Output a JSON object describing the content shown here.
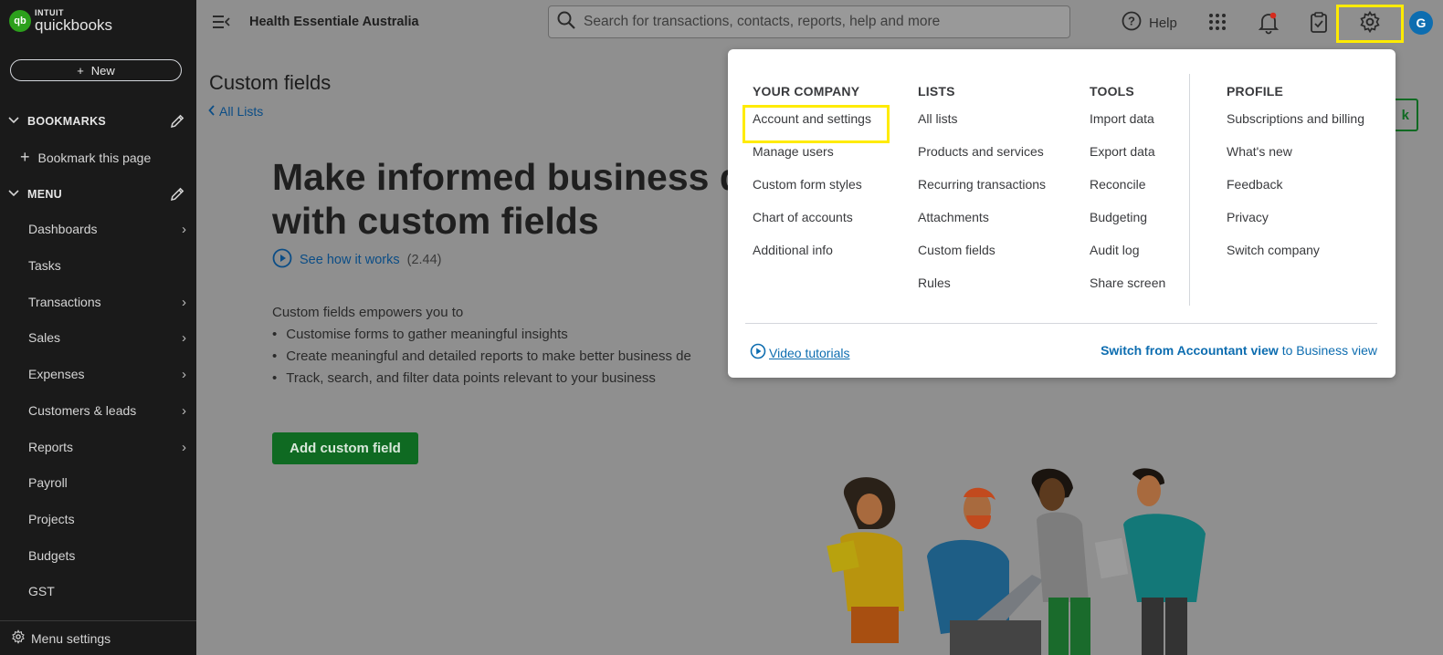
{
  "brand": {
    "intuit": "INTUIT",
    "product": "quickbooks",
    "mark": "qb"
  },
  "sidebar": {
    "new_label": "New",
    "bookmarks_header": "BOOKMARKS",
    "bookmark_this_page": "Bookmark this page",
    "menu_header": "MENU",
    "items": [
      {
        "label": "Dashboards",
        "has_arrow": true
      },
      {
        "label": "Tasks",
        "has_arrow": false
      },
      {
        "label": "Transactions",
        "has_arrow": true
      },
      {
        "label": "Sales",
        "has_arrow": true
      },
      {
        "label": "Expenses",
        "has_arrow": true
      },
      {
        "label": "Customers & leads",
        "has_arrow": true
      },
      {
        "label": "Reports",
        "has_arrow": true
      },
      {
        "label": "Payroll",
        "has_arrow": false
      },
      {
        "label": "Projects",
        "has_arrow": false
      },
      {
        "label": "Budgets",
        "has_arrow": false
      },
      {
        "label": "GST",
        "has_arrow": false
      }
    ],
    "menu_settings": "Menu settings"
  },
  "topbar": {
    "company_name": "Health Essentiale Australia",
    "search_placeholder": "Search for transactions, contacts, reports, help and more",
    "help_label": "Help",
    "avatar_initial": "G"
  },
  "main": {
    "page_title": "Custom fields",
    "back_link": "All Lists",
    "headline_line1": "Make informed business d",
    "headline_line2": "with custom fields",
    "see_how": "See how it works",
    "see_how_duration": "(2.44)",
    "intro": "Custom fields empowers you to",
    "bullets": [
      "Customise forms to gather meaningful insights",
      "Create meaningful and detailed reports to make better business de",
      "Track, search, and filter data points relevant to your business"
    ],
    "add_button": "Add custom field",
    "side_button_partial": "k"
  },
  "dropdown": {
    "your_company": {
      "header": "YOUR COMPANY",
      "items": [
        "Account and settings",
        "Manage users",
        "Custom form styles",
        "Chart of accounts",
        "Additional info"
      ]
    },
    "lists": {
      "header": "LISTS",
      "items": [
        "All lists",
        "Products and services",
        "Recurring transactions",
        "Attachments",
        "Custom fields",
        "Rules"
      ]
    },
    "tools": {
      "header": "TOOLS",
      "items": [
        "Import data",
        "Export data",
        "Reconcile",
        "Budgeting",
        "Audit log",
        "Share screen"
      ]
    },
    "profile": {
      "header": "PROFILE",
      "items": [
        "Subscriptions and billing",
        "What's new",
        "Feedback",
        "Privacy",
        "Switch company"
      ]
    },
    "video_tutorials": "Video tutorials",
    "switch_bold": "Switch from Accountant view",
    "switch_rest": " to Business view"
  },
  "colors": {
    "accent_green": "#2ca01c",
    "link_blue": "#0d6db0",
    "highlight": "#ffeb00",
    "sidebar_bg": "#1a1a1a"
  }
}
